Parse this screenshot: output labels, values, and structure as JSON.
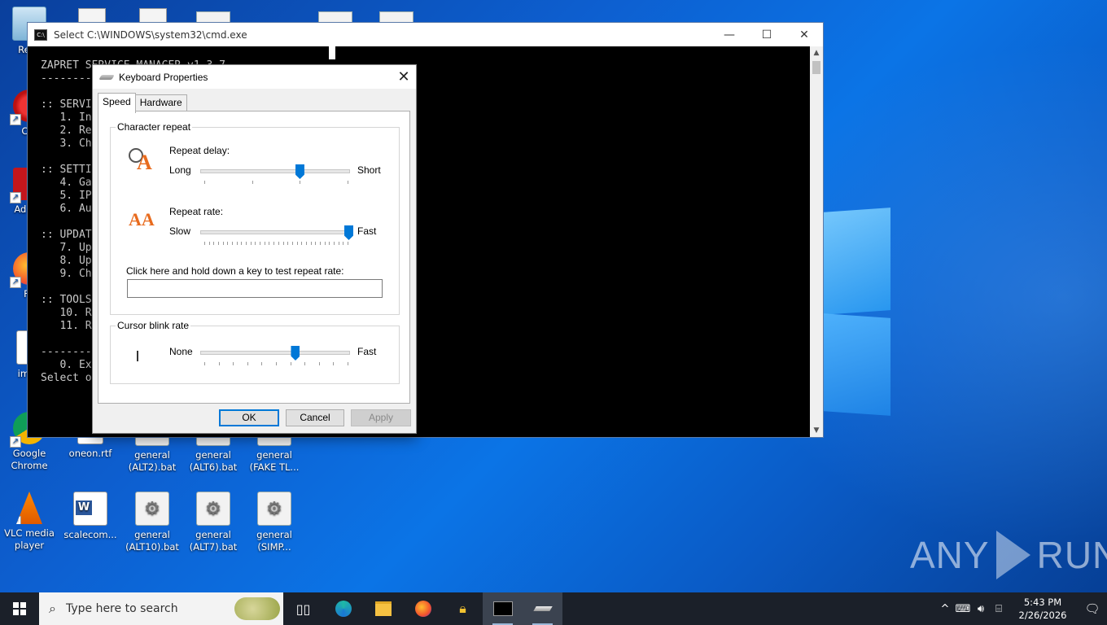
{
  "desktop": {
    "icons": [
      {
        "label": "Recy"
      },
      {
        "label": "CCl"
      },
      {
        "label": "Ad Acr"
      },
      {
        "label": "Fir"
      },
      {
        "label": "impo"
      },
      {
        "label": "Google Chrome"
      },
      {
        "label": "oneon.rtf"
      },
      {
        "label": "general (ALT2).bat"
      },
      {
        "label": "general (ALT6).bat"
      },
      {
        "label": "general (FAKE TL..."
      },
      {
        "label": "VLC media player"
      },
      {
        "label": "scalecom..."
      },
      {
        "label": "general (ALT10).bat"
      },
      {
        "label": "general (ALT7).bat"
      },
      {
        "label": "general (SIMP..."
      }
    ]
  },
  "cmd": {
    "title": "Select C:\\WINDOWS\\system32\\cmd.exe",
    "lines": [
      "ZAPRET SERVICE MANAGER v1.3.7",
      "--------",
      "",
      ":: SERVI",
      "   1. In",
      "   2. Re",
      "   3. Ch",
      "",
      ":: SETTI",
      "   4. Ga",
      "   5. IP",
      "   6. Au",
      "",
      ":: UPDAT",
      "   7. Up",
      "   8. Up",
      "   9. Ch",
      "",
      ":: TOOLS",
      "   10. R",
      "   11. R",
      "",
      "--------",
      "   0. Ex",
      "Select opt"
    ]
  },
  "dialog": {
    "title": "Keyboard Properties",
    "tabs": [
      "Speed",
      "Hardware"
    ],
    "character_repeat": {
      "group_label": "Character repeat",
      "delay_label": "Repeat delay:",
      "delay_left": "Long",
      "delay_right": "Short",
      "delay_level": 0.67,
      "rate_label": "Repeat rate:",
      "rate_left": "Slow",
      "rate_right": "Fast",
      "rate_level": 1.0,
      "test_label": "Click here and hold down a key to test repeat rate:",
      "test_value": ""
    },
    "cursor_blink": {
      "group_label": "Cursor blink rate",
      "left": "None",
      "right": "Fast",
      "level": 0.64
    },
    "buttons": {
      "ok": "OK",
      "cancel": "Cancel",
      "apply": "Apply"
    }
  },
  "taskbar": {
    "search_placeholder": "Type here to search",
    "clock_time": "5:43 PM",
    "clock_date": "2/26/2026"
  },
  "watermark": {
    "left": "ANY",
    "right": "RUN"
  }
}
